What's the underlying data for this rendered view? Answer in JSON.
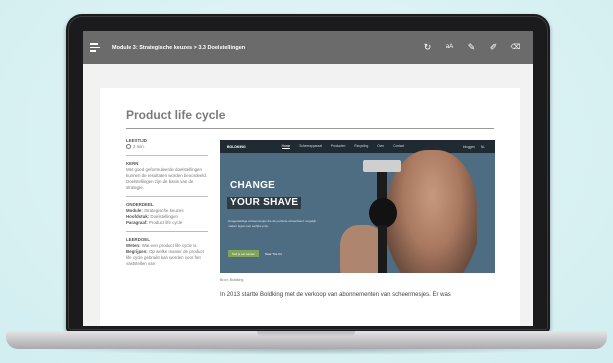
{
  "topbar": {
    "breadcrumb": "Module 3: Strategische keuzes > 3.3 Doelstellingen",
    "tools": [
      {
        "icon": "refresh-icon",
        "glyph": "↻"
      },
      {
        "icon": "text-size-icon",
        "glyph": "aA"
      },
      {
        "icon": "pencil-icon",
        "glyph": "✎"
      },
      {
        "icon": "highlighter-icon",
        "glyph": "✐"
      },
      {
        "icon": "eraser-icon",
        "glyph": "⌫"
      }
    ]
  },
  "page": {
    "title": "Product life cycle"
  },
  "sidebar": {
    "reading_time_label": "LEESTIJD",
    "reading_time_value": "2 min.",
    "core_label": "KERN",
    "core_text": "Met goed geformuleerde doelstellingen kunnen de resultaten worden beoordeeld. Doelstellingen zijn de basis van de strategie.",
    "subject_label": "ONDERDEEL",
    "module_key": "Module:",
    "module_value": "Strategische keuzes",
    "chapter_key": "Hoofdstuk:",
    "chapter_value": "Doelstellingen",
    "paragraph_key": "Paragraaf:",
    "paragraph_value": "Product life cycle",
    "goal_label": "LEERDOEL",
    "knowing_key": "Weten:",
    "knowing_value": "Wat een product life cycle is.",
    "understand_key": "Begrijpen:",
    "understand_value": "Op welke manier de product life cycle gebruikt kan worden voor het vaststellen van"
  },
  "hero": {
    "logo": "BOLDKING",
    "nav_links": [
      "Home",
      "Scheerapparaat",
      "Producten",
      "Recycling",
      "Over",
      "Contact"
    ],
    "nav_right": [
      "Inloggen",
      "NL"
    ],
    "headline_1": "CHANGE",
    "headline_2": "YOUR SHAVE",
    "copy": "Hoogwaardige scheermesjes die de perfecte scheerbeurt mogelijk maken tegen een eerlijke prijs.",
    "cta": "Stel je set samen",
    "cta_secondary": "Naar The Kit"
  },
  "content": {
    "caption": "Bron: Boldking",
    "body": "In 2013 startte Boldking met de verkoop van abonnementen van scheermesjes. Er was"
  }
}
